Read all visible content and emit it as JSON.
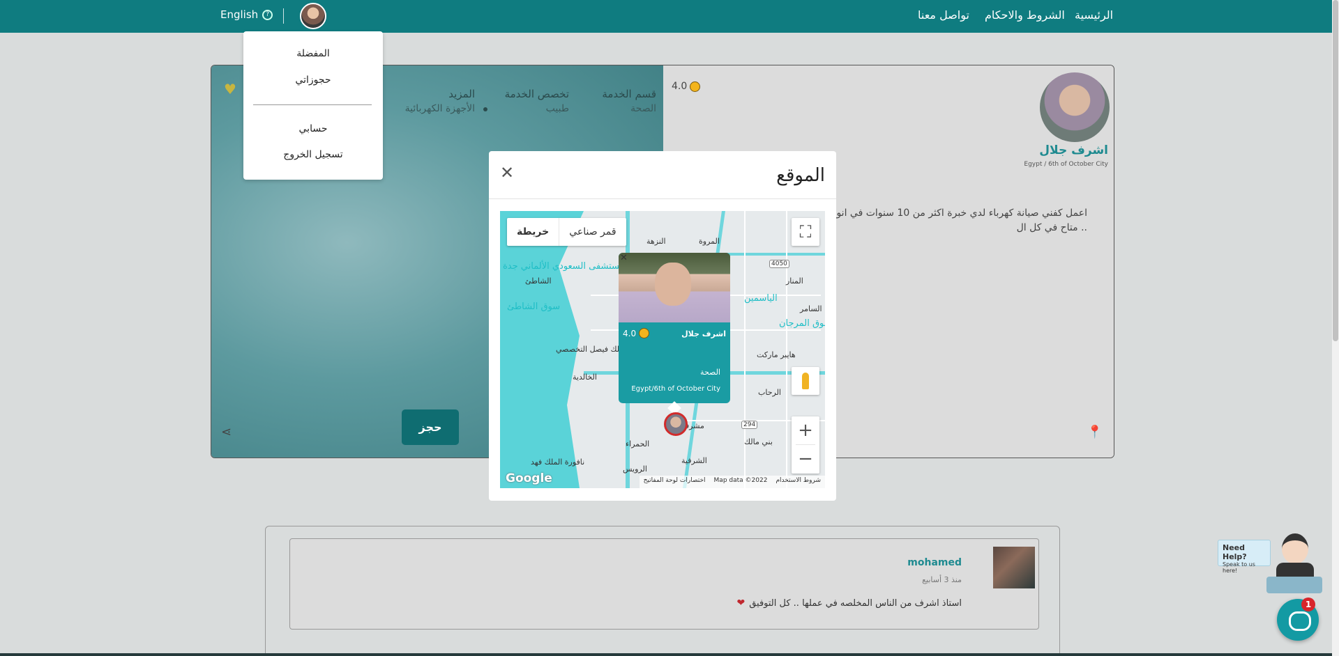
{
  "nav": {
    "links": [
      "الرئيسية",
      "الشروط والاحكام",
      "تواصل معنا"
    ],
    "language": "English"
  },
  "dropdown": {
    "items_top": [
      "المفضلة",
      "حجوزاتي"
    ],
    "items_bottom": [
      "حسابي",
      "تسجيل الخروج"
    ]
  },
  "profile": {
    "name": "اشرف جلال",
    "location": "Egypt / 6th of October City",
    "rating": "4.0",
    "bio": "اعمل كفني صيانة كهرباء لدي خبرة اكثر من 10 سنوات في انواعها بافضل الاسعار وباعلي جودة .. متاح في كل ال",
    "book_label": "حجز",
    "service_section_header": "قسم الخدمة",
    "service_section_value": "الصحة",
    "service_specialty_header": "تخصص الخدمة",
    "service_specialty_value": "طبيب",
    "more_header": "المزيد",
    "more_value": "الأجهزة الكهربائية"
  },
  "review": {
    "author": "mohamed",
    "time": "منذ 3 أسابيع",
    "text": "استاذ اشرف من الناس المخلصه في عملها .. كل التوفيق"
  },
  "modal": {
    "title": "الموقع",
    "map_type_map": "خريطة",
    "map_type_satellite": "قمر صناعي",
    "footer_terms": "شروط الاستخدام",
    "footer_data": "Map data ©2022",
    "footer_shortcuts": "اختصارات لوحة المفاتيح",
    "google": "Google",
    "labels": {
      "nuzha": "النزهة",
      "marwa": "المروة",
      "hospital_saudi_german": "مستشفى السعودي الألماني جدة",
      "shati": "الشاطئ",
      "souq_shati": "سوق الشاطئ",
      "hospital_king": "مستشفى الملك فيصل التخصصي",
      "khalidiya": "الخالدية",
      "hamra": "الحمراء",
      "rehab": "الرحاب",
      "mushrifa": "مشرفة",
      "sharafiya": "الشرفية",
      "ruwais": "الرويس",
      "bani_malik": "بني مالك",
      "fountain": "نافورة الملك فهد",
      "yasmin": "الياسمين",
      "souq_morjan": "سوق المرجان",
      "market": "هايبر ماركت",
      "samer": "السامر",
      "manar": "المنار",
      "road_4050": "4050",
      "road_294": "294"
    },
    "infowindow": {
      "name": "اشرف جلال",
      "rating": "4.0",
      "category": "الصحة",
      "city": "Egypt/6th of October City"
    }
  },
  "help": {
    "title": "Need Help?",
    "subtitle": "Speak to us here!",
    "badge": "1"
  },
  "colors": {
    "primary": "#0f7c80",
    "accent_text": "#1e8a90",
    "map_water": "#5ad3d8"
  }
}
